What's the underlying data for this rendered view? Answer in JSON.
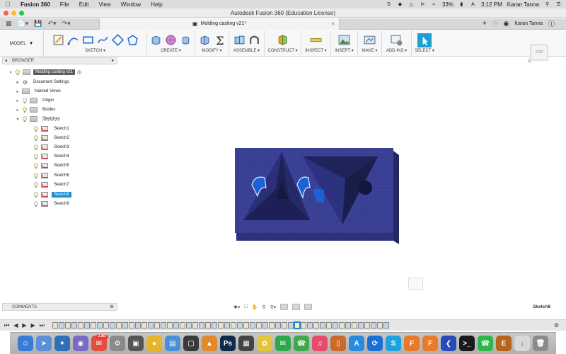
{
  "menubar": {
    "app_name": "Fusion 360",
    "items": [
      "File",
      "Edit",
      "View",
      "Window",
      "Help"
    ],
    "battery": "33%",
    "time": "3:12 PM",
    "user": "Karan Tanna"
  },
  "window": {
    "title": "Autodesk Fusion 360 (Education License)"
  },
  "tabbar": {
    "doc_tab": "Molding casting v21*",
    "user": "Karan Tanna"
  },
  "ribbon": {
    "workspace": "MODEL",
    "groups": [
      "SKETCH",
      "CREATE",
      "MODIFY",
      "ASSEMBLE",
      "CONSTRUCT",
      "INSPECT",
      "INSERT",
      "MAKE",
      "ADD-INS",
      "SELECT"
    ]
  },
  "viewcube": {
    "face": "TOP"
  },
  "browser": {
    "title": "BROWSER",
    "root": "Molding casting v21",
    "nodes": [
      "Document Settings",
      "Named Views",
      "Origin",
      "Bodies",
      "Sketches"
    ],
    "sketches": [
      "Sketch1",
      "Sketch2",
      "Sketch3",
      "Sketch4",
      "Sketch5",
      "Sketch6",
      "Sketch7",
      "Sketch8",
      "Sketch9"
    ],
    "selected": "Sketch8"
  },
  "comments": {
    "title": "COMMENTS"
  },
  "status": {
    "active_sketch": "Sketch8"
  },
  "colors": {
    "accent": "#1c8bd6",
    "model_blue": "#333a8c",
    "highlight_blue": "#1a62d6",
    "select_button": "#1aa0d8"
  },
  "dock": {
    "mail_badge": "2,967"
  }
}
